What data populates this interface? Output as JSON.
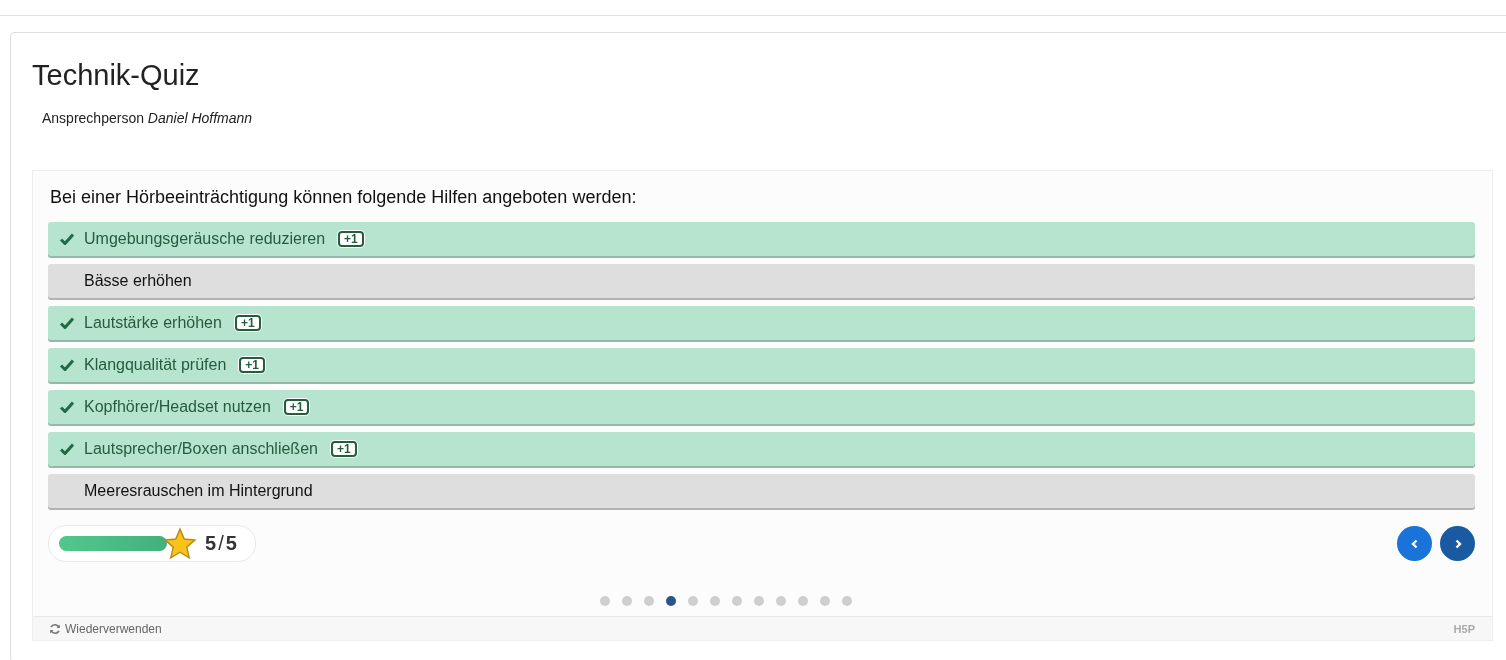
{
  "title": "Technik-Quiz",
  "contact": {
    "label": "Ansprechperson",
    "name": "Daniel Hoffmann"
  },
  "question": "Bei einer Hörbeeinträchtigung können folgende Hilfen angeboten werden:",
  "options": [
    {
      "label": "Umgebungsgeräusche reduzieren",
      "selected": true,
      "badge": "+1"
    },
    {
      "label": "Bässe erhöhen",
      "selected": false
    },
    {
      "label": "Lautstärke erhöhen",
      "selected": true,
      "badge": "+1"
    },
    {
      "label": "Klangqualität prüfen",
      "selected": true,
      "badge": "+1"
    },
    {
      "label": "Kopfhörer/Headset nutzen",
      "selected": true,
      "badge": "+1"
    },
    {
      "label": "Lautsprecher/Boxen anschließen",
      "selected": true,
      "badge": "+1"
    },
    {
      "label": "Meeresrauschen im Hintergrund",
      "selected": false
    }
  ],
  "score": {
    "level": 1,
    "value": "5",
    "separator": "/",
    "max": "5"
  },
  "pages": [
    {
      "selected": false
    },
    {
      "selected": false
    },
    {
      "selected": false
    },
    {
      "selected": true
    },
    {
      "selected": false
    },
    {
      "selected": false
    },
    {
      "selected": false
    },
    {
      "selected": false
    },
    {
      "selected": false
    },
    {
      "selected": false
    },
    {
      "selected": false
    },
    {
      "selected": false
    }
  ],
  "footer": {
    "reuse": "Wiederverwenden",
    "logo": "H5P"
  }
}
